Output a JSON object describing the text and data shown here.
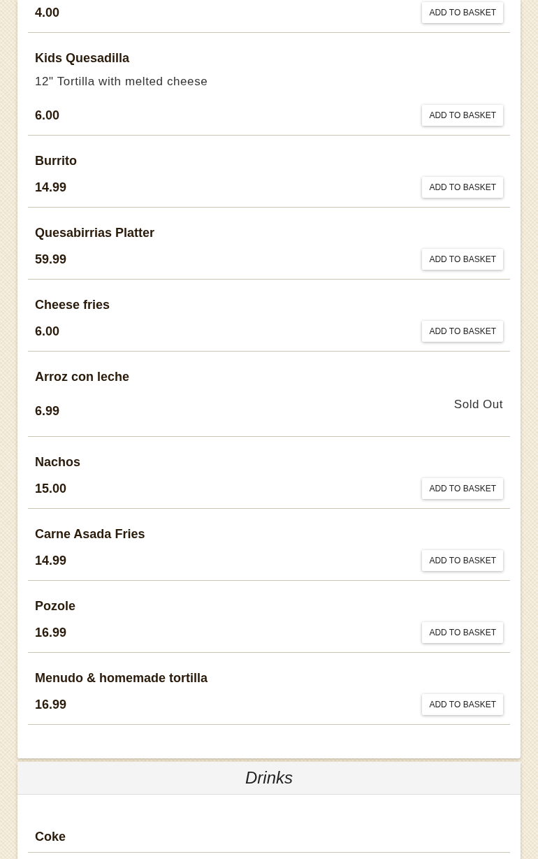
{
  "sections": [
    {
      "items": [
        {
          "price": "4.00",
          "sold_out": false,
          "button": "ADD TO BASKET"
        },
        {
          "name": "Kids Quesadilla",
          "description": "12\" Tortilla with melted cheese",
          "price": "6.00",
          "sold_out": false,
          "button": "ADD TO BASKET"
        },
        {
          "name": "Burrito",
          "price": "14.99",
          "sold_out": false,
          "button": "ADD TO BASKET"
        },
        {
          "name": "Quesabirrias Platter",
          "price": "59.99",
          "sold_out": false,
          "button": "ADD TO BASKET"
        },
        {
          "name": "Cheese fries",
          "price": "6.00",
          "sold_out": false,
          "button": "ADD TO BASKET"
        },
        {
          "name": "Arroz con leche",
          "price": "6.99",
          "sold_out": true,
          "status": "Sold Out"
        },
        {
          "name": "Nachos",
          "price": "15.00",
          "sold_out": false,
          "button": "ADD TO BASKET"
        },
        {
          "name": "Carne Asada Fries",
          "price": "14.99",
          "sold_out": false,
          "button": "ADD TO BASKET"
        },
        {
          "name": "Pozole",
          "price": "16.99",
          "sold_out": false,
          "button": "ADD TO BASKET"
        },
        {
          "name": "Menudo & homemade tortilla",
          "price": "16.99",
          "sold_out": false,
          "button": "ADD TO BASKET"
        }
      ]
    },
    {
      "title": "Drinks",
      "items": [
        {
          "name": "Coke"
        }
      ]
    }
  ]
}
